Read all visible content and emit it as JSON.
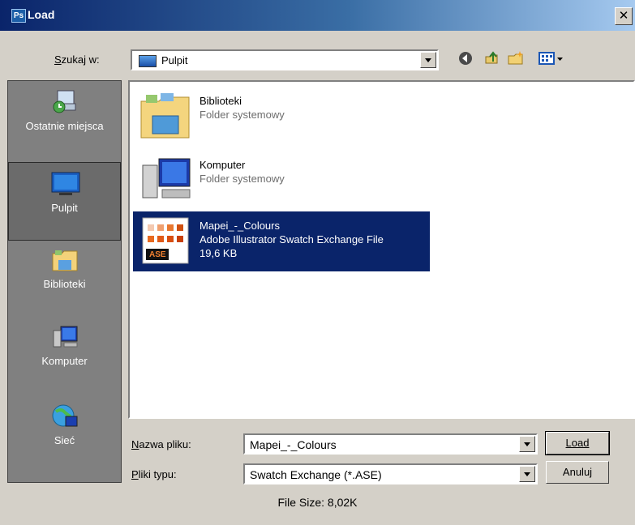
{
  "window": {
    "app_badge": "Ps",
    "title": "Load",
    "close_glyph": "✕"
  },
  "toolbar": {
    "look_in_label": "Szukaj w:",
    "look_in_value": "Pulpit",
    "icons": [
      "back-icon",
      "up-folder-icon",
      "new-folder-icon",
      "view-menu-icon"
    ]
  },
  "places": [
    {
      "label": "Ostatnie miejsca",
      "icon": "recent-places-icon"
    },
    {
      "label": "Pulpit",
      "icon": "desktop-icon",
      "selected": true
    },
    {
      "label": "Biblioteki",
      "icon": "libraries-icon"
    },
    {
      "label": "Komputer",
      "icon": "computer-icon"
    },
    {
      "label": "Sieć",
      "icon": "network-icon"
    }
  ],
  "files": [
    {
      "name": "Biblioteki",
      "type": "Folder systemowy",
      "size": "",
      "icon": "libraries-folder-icon"
    },
    {
      "name": "Komputer",
      "type": "Folder systemowy",
      "size": "",
      "icon": "computer-icon"
    },
    {
      "name": "Mapei_-_Colours",
      "type": "Adobe Illustrator Swatch Exchange File",
      "size": "19,6 KB",
      "icon": "ase-file-icon",
      "badge": "ASE",
      "selected": true
    }
  ],
  "form": {
    "filename_label": "Nazwa pliku:",
    "filename_value": "Mapei_-_Colours",
    "filetype_label": "Pliki typu:",
    "filetype_value": "Swatch Exchange (*.ASE)",
    "load_label": "Load",
    "cancel_label": "Anuluj"
  },
  "footer": {
    "file_size": "File Size: 8,02K"
  },
  "colors": {
    "selection": "#0a246a",
    "dialog_bg": "#d4d0c8",
    "places_bg": "#808080"
  }
}
